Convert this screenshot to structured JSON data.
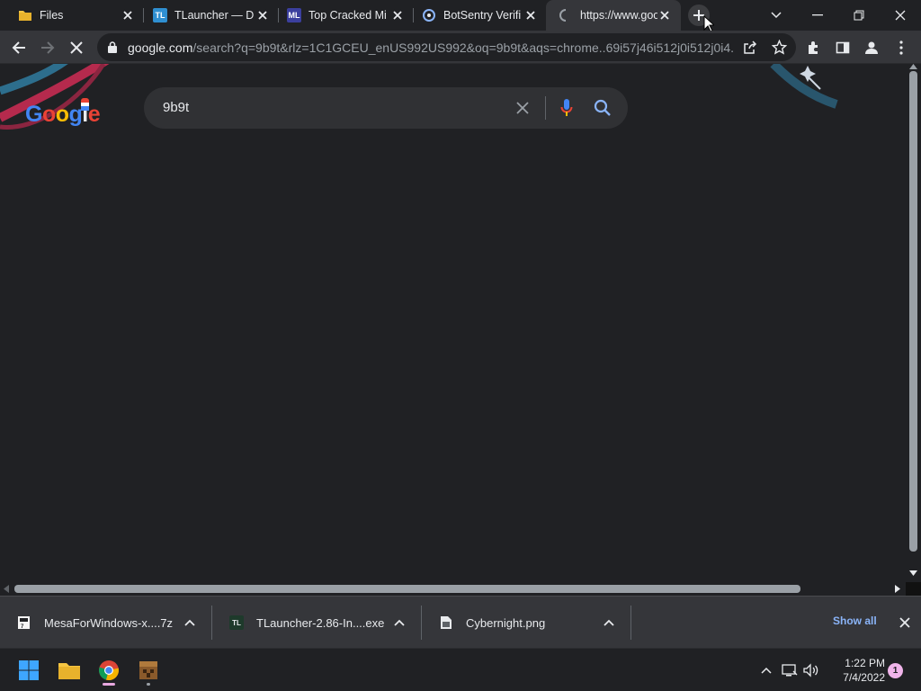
{
  "browser": {
    "tabs": [
      {
        "title": "Files",
        "favicon": "folder-icon",
        "active": false
      },
      {
        "title": "TLauncher — D",
        "favicon": "tlauncher-icon",
        "active": false
      },
      {
        "title": "Top Cracked Mi",
        "favicon": "ml-icon",
        "active": false
      },
      {
        "title": "BotSentry Verifi",
        "favicon": "botsentry-icon",
        "active": false
      },
      {
        "title": "https://www.goo",
        "favicon": "loading-spinner-icon",
        "active": true
      }
    ],
    "favicon_text": {
      "tlauncher": "TL",
      "ml": "ML"
    },
    "address": {
      "host": "google.com",
      "path": "/search?q=9b9t&rlz=1C1GCEU_enUS992US992&oq=9b9t&aqs=chrome..69i57j46i512j0i512j0i4..."
    }
  },
  "page": {
    "logo_text": "Google",
    "search_query": "9b9t"
  },
  "downloads": {
    "items": [
      {
        "name": "MesaForWindows-x....7z",
        "icon": "archive-icon"
      },
      {
        "name": "TLauncher-2.86-In....exe",
        "icon": "tlauncher-icon"
      },
      {
        "name": "Cybernight.png",
        "icon": "image-file-icon"
      }
    ],
    "show_all": "Show all"
  },
  "taskbar": {
    "time": "1:22 PM",
    "date": "7/4/2022",
    "notification_count": "1"
  },
  "colors": {
    "background": "#202124",
    "toolbar": "#35363a",
    "accent_link": "#8ab4f8"
  }
}
